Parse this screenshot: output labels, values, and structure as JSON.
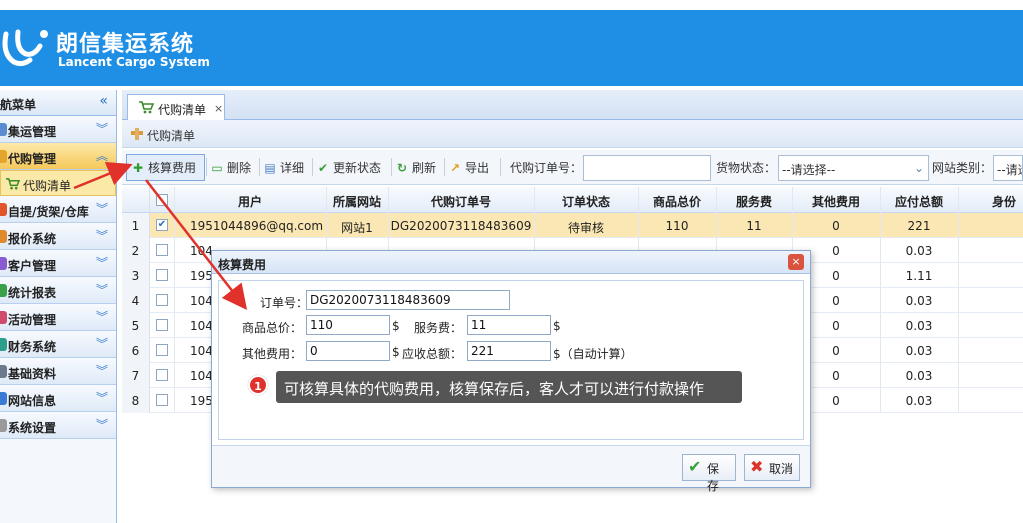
{
  "app": {
    "title_cn": "朗信集运系统",
    "title_en": "Lancent Cargo System"
  },
  "sidebar": {
    "header": "导航菜单",
    "collapse_glyph": "«",
    "items": [
      {
        "label": "集运管理",
        "icon_color": "#5b8bd0"
      },
      {
        "label": "代购管理",
        "icon_color": "#e3a52b",
        "active": true
      },
      {
        "label": "自提/货架/仓库",
        "icon_color": "#e2542a"
      },
      {
        "label": "报价系统",
        "icon_color": "#e08a2b"
      },
      {
        "label": "客户管理",
        "icon_color": "#8a5bd0"
      },
      {
        "label": "统计报表",
        "icon_color": "#3aa04a"
      },
      {
        "label": "活动管理",
        "icon_color": "#d04a6b"
      },
      {
        "label": "财务系统",
        "icon_color": "#2e9e8c"
      },
      {
        "label": "基础资料",
        "icon_color": "#6b7b8c"
      },
      {
        "label": "网站信息",
        "icon_color": "#3a7bd5"
      },
      {
        "label": "系统设置",
        "icon_color": "#9a9a9a"
      }
    ],
    "sub_item": "代购清单"
  },
  "tabs": [
    {
      "label": "代购清单",
      "close": "×"
    }
  ],
  "panel_title": "代购清单",
  "toolbar": {
    "buttons": [
      "核算费用",
      "删除",
      "详细",
      "更新状态",
      "刷新",
      "导出"
    ],
    "order_no_label": "代购订单号：",
    "order_no_value": "",
    "goods_status_label": "货物状态：",
    "goods_status_value": "--请选择--",
    "site_type_label": "网站类别：",
    "site_type_value": "--请选"
  },
  "grid": {
    "headers": [
      "用户",
      "所属网站",
      "代购订单号",
      "订单状态",
      "商品总价",
      "服务费",
      "其他费用",
      "应付总额",
      "身份"
    ],
    "rows": [
      {
        "n": "1",
        "user": "1951044896@qq.com",
        "site": "网站1",
        "order": "DG2020073118483609",
        "status": "待审核",
        "total": "110",
        "fee": "11",
        "other": "0",
        "pay": "221",
        "checked": true
      },
      {
        "n": "2",
        "user": "104",
        "site": "",
        "order": "",
        "status": "",
        "total": "",
        "fee": "",
        "other": "0",
        "pay": "0.03",
        "checked": false
      },
      {
        "n": "3",
        "user": "195",
        "site": "",
        "order": "",
        "status": "",
        "total": "",
        "fee": "",
        "other": "0",
        "pay": "1.11",
        "checked": false
      },
      {
        "n": "4",
        "user": "104",
        "site": "",
        "order": "",
        "status": "",
        "total": "",
        "fee": "",
        "other": "0",
        "pay": "0.03",
        "checked": false
      },
      {
        "n": "5",
        "user": "104",
        "site": "",
        "order": "",
        "status": "",
        "total": "",
        "fee": "",
        "other": "0",
        "pay": "0.03",
        "checked": false
      },
      {
        "n": "6",
        "user": "104",
        "site": "",
        "order": "",
        "status": "",
        "total": "",
        "fee": "",
        "other": "0",
        "pay": "0.03",
        "checked": false
      },
      {
        "n": "7",
        "user": "104",
        "site": "",
        "order": "",
        "status": "",
        "total": "",
        "fee": "",
        "other": "0",
        "pay": "0.03",
        "checked": false
      },
      {
        "n": "8",
        "user": "195",
        "site": "",
        "order": "",
        "status": "",
        "total": "",
        "fee": "",
        "other": "0",
        "pay": "0.03",
        "checked": false
      }
    ]
  },
  "dialog": {
    "title": "核算费用",
    "close": "×",
    "order_no_label": "订单号：",
    "order_no_value": "DG2020073118483609",
    "goods_total_label": "商品总价：",
    "goods_total_value": "110",
    "service_fee_label": "服务费：",
    "service_fee_value": "11",
    "other_fee_label": "其他费用：",
    "other_fee_value": "0",
    "receivable_label": "应收总额：",
    "receivable_value": "221",
    "currency": "$",
    "auto_calc": "$（自动计算）",
    "save_label": "保存",
    "cancel_label": "取消"
  },
  "annotation": {
    "number": "1",
    "text": "可核算具体的代购费用，核算保存后，客人才可以进行付款操作",
    "color": "#e0322b"
  }
}
